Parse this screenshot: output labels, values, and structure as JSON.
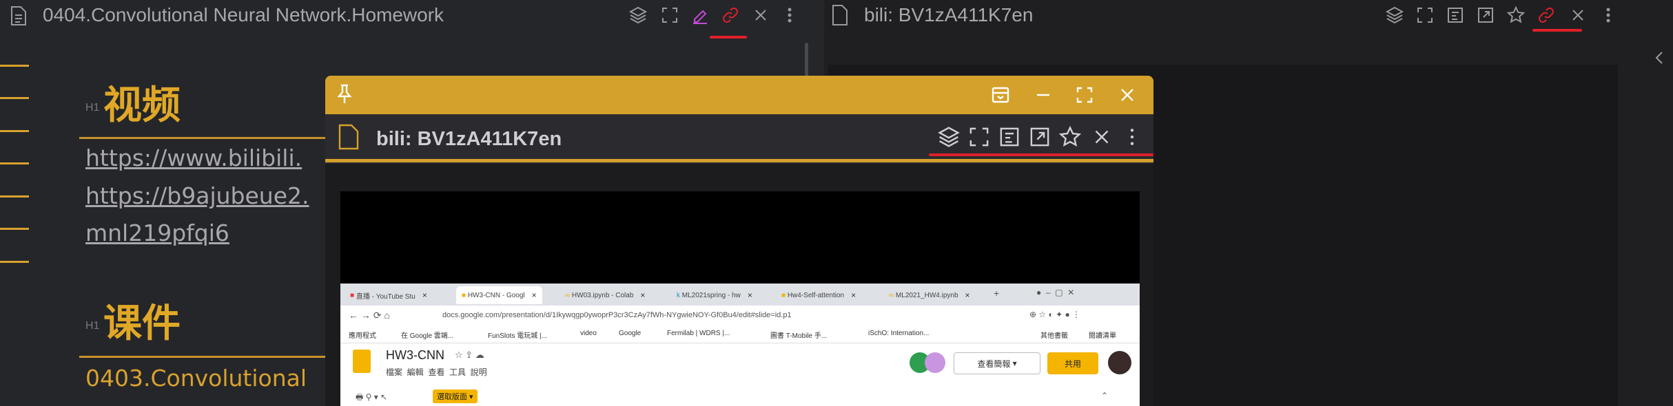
{
  "left_pane": {
    "title": "0404.Convolutional Neural Network.Homework",
    "icons": [
      "layers-icon",
      "fullscreen-icon",
      "edit-icon",
      "link-icon",
      "close-icon",
      "more-icon"
    ],
    "sections": [
      {
        "tag": "H1",
        "heading": "视频"
      },
      {
        "tag": "H1",
        "heading": "课件"
      }
    ],
    "links": [
      "https://www.bilibili.",
      "https://b9ajubeue2.",
      "mnl219pfqi6"
    ],
    "next_text": "0403.Convolutional"
  },
  "right_pane": {
    "title": "bili: BV1zA411K7en",
    "icons": [
      "layers-icon",
      "fullscreen-icon",
      "export-icon",
      "open-icon",
      "star-icon",
      "link-icon",
      "close-icon",
      "more-icon"
    ]
  },
  "popup": {
    "title": "bili: BV1zA411K7en",
    "window_controls": [
      "pin-icon",
      "dock-icon",
      "minimize-icon",
      "maximize-icon",
      "close-icon"
    ],
    "toolbar_icons": [
      "layers-icon",
      "fullscreen-icon",
      "export-icon",
      "open-icon",
      "star-icon",
      "close-icon",
      "more-icon"
    ]
  },
  "video_screen": {
    "tabs": [
      "直播 - YouTube Stu",
      "HW3-CNN - Googl",
      "HW03.ipynb - Colab",
      "ML2021spring - hw",
      "Hw4-Self-attention",
      "ML2021_HW4.ipynb"
    ],
    "url": "docs.google.com/presentation/d/1Ikywqgp0ywoprP3cr3CzAy7fWh-NYgwieNOY-Gf0Bu4/edit#slide=id.p1",
    "bookmarks": [
      "應用程式",
      "在 Google 雲端...",
      "FunSlots 電玩城 |...",
      "video",
      "Google",
      "Fermilab | WDRS |...",
      "圖書 T-Mobile 手...",
      "iSchO: Internation...",
      "其他書籤",
      "閱讀清單"
    ],
    "doc_title": "HW3-CNN",
    "menu": "檔案  編輯  查看  工具  說明",
    "present_label": "查看簡報",
    "share_label": "共用",
    "toolbar_button": "選取版面"
  },
  "colors": {
    "accent": "#d4a12a",
    "link_red": "#e0202a",
    "heading": "#e0a826"
  }
}
